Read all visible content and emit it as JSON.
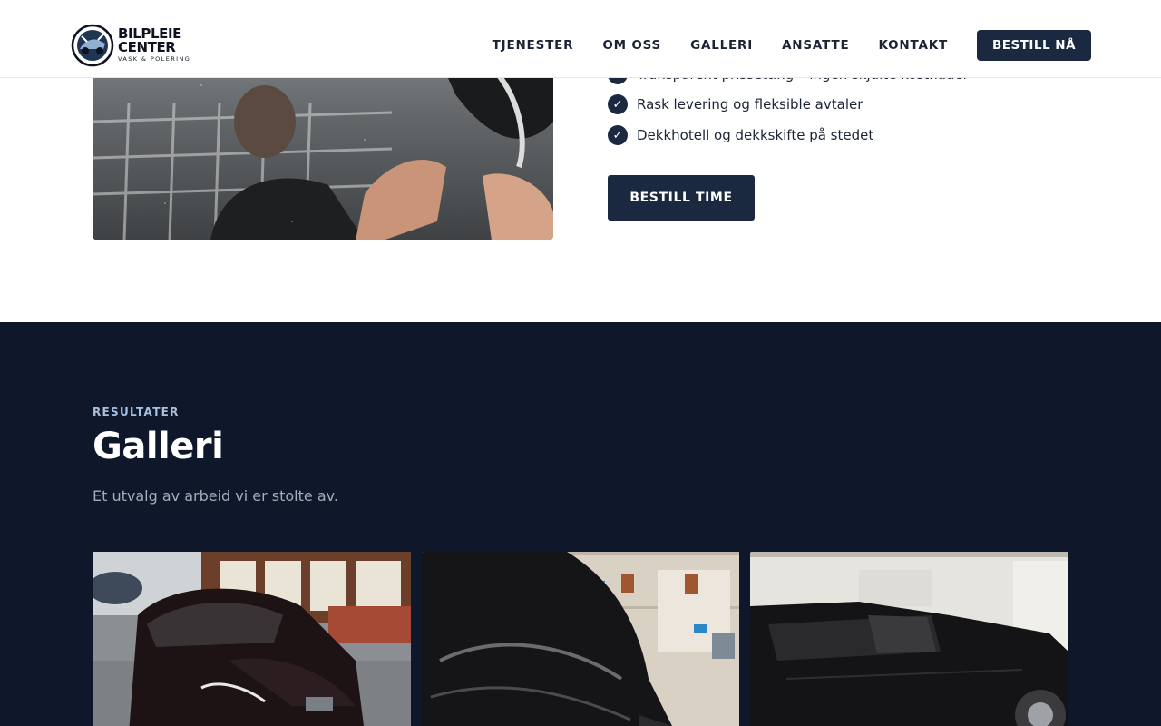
{
  "header": {
    "logo": {
      "title": "BILPLEIE CENTER",
      "subtitle": "VASK & POLERING"
    },
    "nav": [
      {
        "label": "TJENESTER"
      },
      {
        "label": "OM OSS"
      },
      {
        "label": "GALLERI"
      },
      {
        "label": "ANSATTE"
      },
      {
        "label": "KONTAKT"
      }
    ],
    "cta_label": "BESTILL NÅ"
  },
  "about": {
    "features": [
      {
        "label": "Transparent prissetting – ingen skjulte kostnader"
      },
      {
        "label": "Rask levering og fleksible avtaler"
      },
      {
        "label": "Dekkhotell og dekkskifte på stedet"
      }
    ],
    "book_label": "BESTILL TIME"
  },
  "gallery": {
    "eyebrow": "RESULTATER",
    "title": "Galleri",
    "subtitle": "Et utvalg av arbeid vi er stolte av."
  },
  "colors": {
    "primary": "#1b2940",
    "gallery_bg": "#0f172a",
    "eyebrow": "#a8c1e0"
  },
  "icons": [
    "check-icon",
    "logo-badge-icon"
  ]
}
